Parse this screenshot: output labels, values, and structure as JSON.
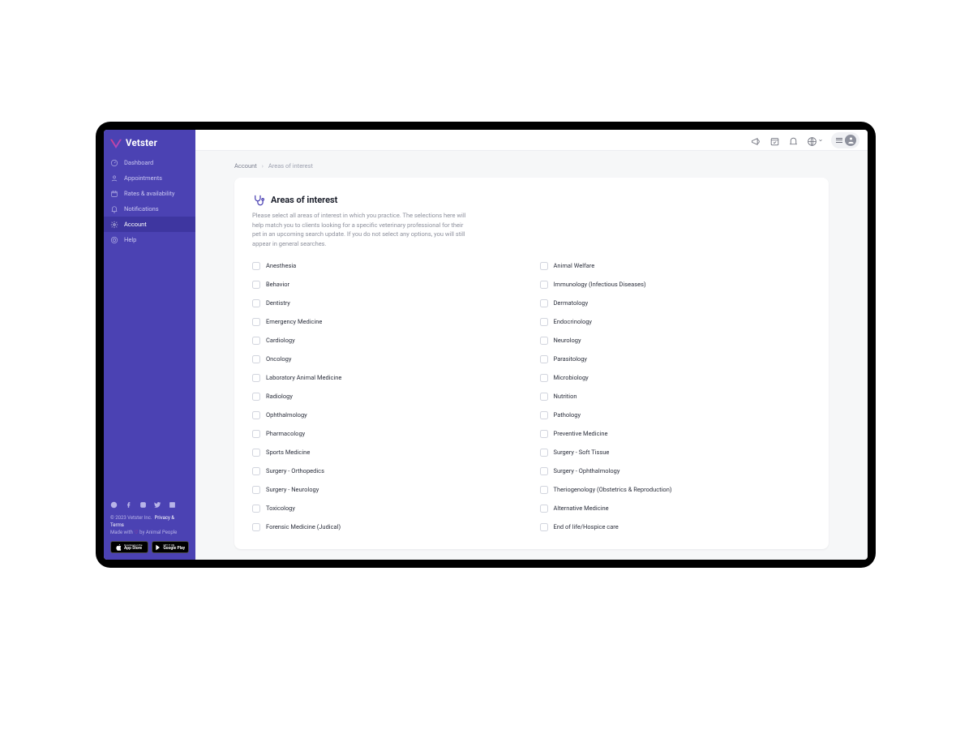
{
  "brand": {
    "name": "Vetster"
  },
  "sidebar": {
    "items": [
      {
        "label": "Dashboard"
      },
      {
        "label": "Appointments"
      },
      {
        "label": "Rates & availability"
      },
      {
        "label": "Notifications"
      },
      {
        "label": "Account"
      },
      {
        "label": "Help"
      }
    ],
    "active_index": 4
  },
  "footer": {
    "copyright": "© 2023 Vetster Inc.",
    "privacy": "Privacy & Terms",
    "made_with_pre": "Made with ",
    "made_with_post": " by Animal People",
    "app_store": {
      "top": "Download on the",
      "bottom": "App Store"
    },
    "google_play": {
      "top": "GET IT ON",
      "bottom": "Google Play"
    }
  },
  "breadcrumb": {
    "root": "Account",
    "current": "Areas of interest"
  },
  "card": {
    "title": "Areas of interest",
    "subtitle": "Please select all areas of interest in which you practice. The selections here will help match you to clients looking for a specific veterinary professional for their pet in an upcoming search update. If you do not select any options, you will still appear in general searches."
  },
  "interests": {
    "left": [
      "Anesthesia",
      "Behavior",
      "Dentistry",
      "Emergency Medicine",
      "Cardiology",
      "Oncology",
      "Laboratory Animal Medicine",
      "Radiology",
      "Ophthalmology",
      "Pharmacology",
      "Sports Medicine",
      "Surgery - Orthopedics",
      "Surgery - Neurology",
      "Toxicology",
      "Forensic Medicine (Judical)"
    ],
    "right": [
      "Animal Welfare",
      "Immunology (Infectious Diseases)",
      "Dermatology",
      "Endocrinology",
      "Neurology",
      "Parasitology",
      "Microbiology",
      "Nutrition",
      "Pathology",
      "Preventive Medicine",
      "Surgery - Soft Tissue",
      "Surgery - Ophthalmology",
      "Theriogenology (Obstetrics & Reproduction)",
      "Alternative Medicine",
      "End of life/Hospice care"
    ]
  }
}
